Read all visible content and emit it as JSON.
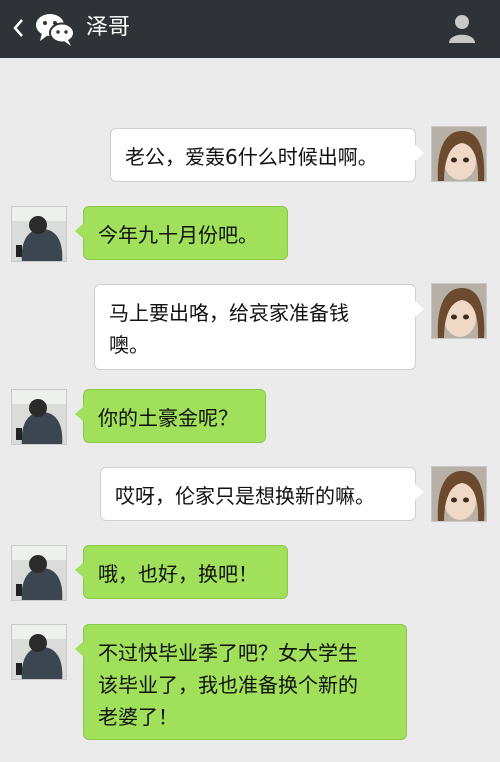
{
  "header": {
    "title": "泽哥",
    "back_icon": "chevron-left-icon",
    "app_icon": "wechat-icon",
    "profile_icon": "person-icon"
  },
  "colors": {
    "header_bg": "#2f3236",
    "chat_bg": "#ebebeb",
    "incoming_bubble": "#a0e05a",
    "outgoing_bubble": "#ffffff"
  },
  "messages": [
    {
      "sender": "me",
      "text": "老公，爱轰6什么时候出啊。"
    },
    {
      "sender": "them",
      "text": "今年九十月份吧。"
    },
    {
      "sender": "me",
      "line1": "马上要出咯，给哀家准备钱",
      "line2": "噢。"
    },
    {
      "sender": "them",
      "text": "你的土豪金呢？"
    },
    {
      "sender": "me",
      "text": "哎呀，伦家只是想换新的嘛。"
    },
    {
      "sender": "them",
      "text": "哦，也好，换吧！"
    },
    {
      "sender": "them",
      "line1": "不过快毕业季了吧？女大学生",
      "line2": "该毕业了，我也准备换个新的",
      "line3": "老婆了！"
    }
  ]
}
